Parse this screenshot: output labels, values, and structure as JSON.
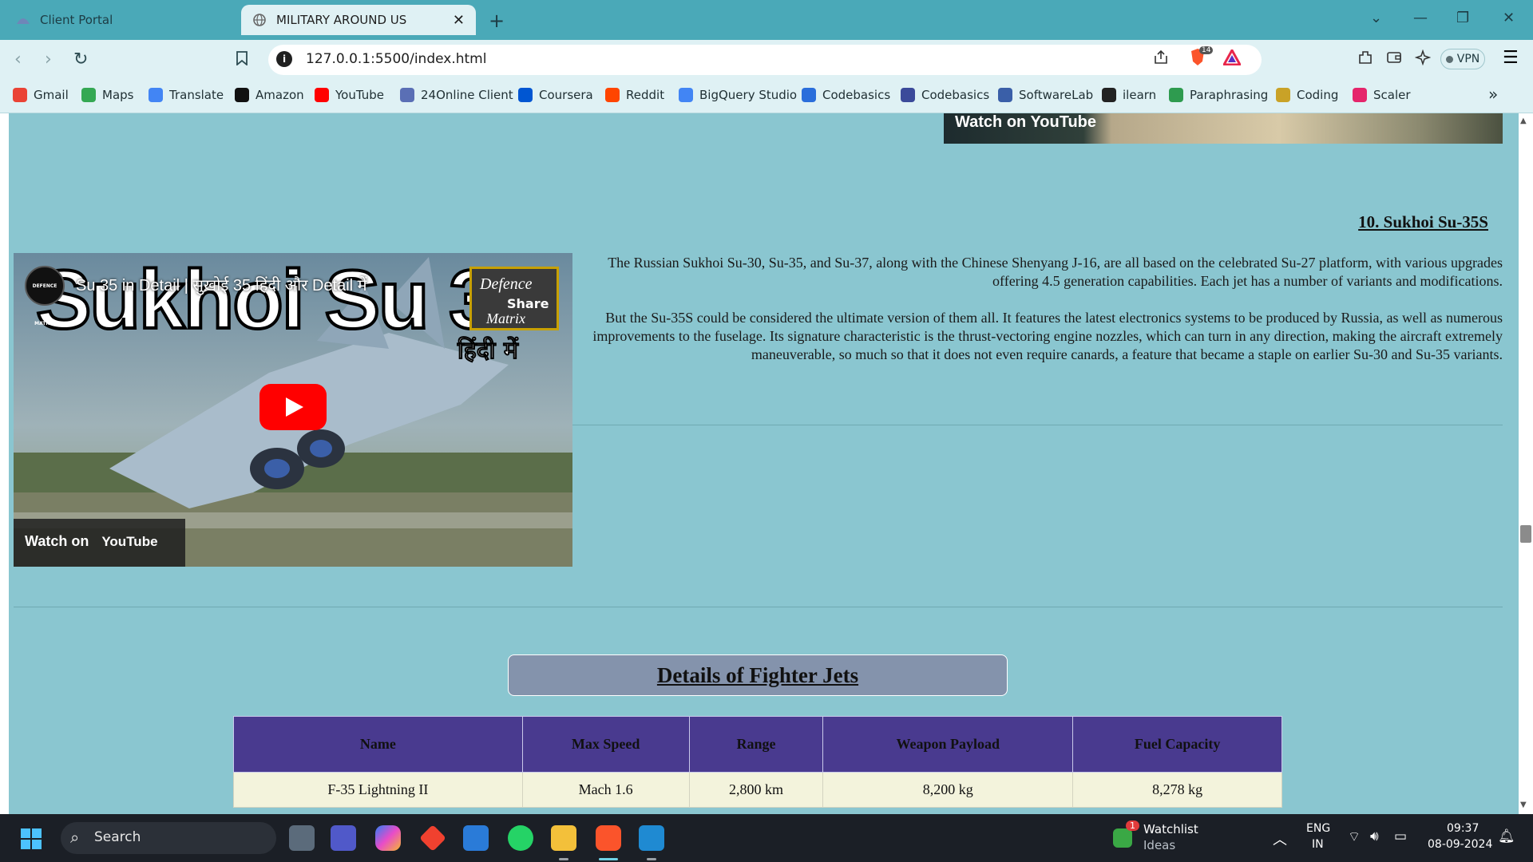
{
  "browser": {
    "tabs": [
      {
        "label": "Client Portal"
      },
      {
        "label": "MILITARY AROUND US"
      }
    ],
    "url": "127.0.0.1:5500/index.html",
    "vpn_label": "VPN",
    "shield_count": "14",
    "bookmarks": [
      {
        "label": "Gmail",
        "icon": "gmail-icon",
        "color": "#ea4335"
      },
      {
        "label": "Maps",
        "icon": "maps-icon",
        "color": "#34a853"
      },
      {
        "label": "Translate",
        "icon": "translate-icon",
        "color": "#4285f4"
      },
      {
        "label": "Amazon",
        "icon": "amazon-icon",
        "color": "#111111"
      },
      {
        "label": "YouTube",
        "icon": "youtube-icon",
        "color": "#ff0000"
      },
      {
        "label": "24Online Client",
        "icon": "24online-icon",
        "color": "#5a6fb5"
      },
      {
        "label": "Coursera",
        "icon": "coursera-icon",
        "color": "#0056d2"
      },
      {
        "label": "Reddit",
        "icon": "reddit-icon",
        "color": "#ff4500"
      },
      {
        "label": "BigQuery Studio",
        "icon": "bigquery-icon",
        "color": "#4285f4"
      },
      {
        "label": "Codebasics",
        "icon": "codebasics-rocket-icon",
        "color": "#2a6edb"
      },
      {
        "label": "Codebasics",
        "icon": "codebasics-icon",
        "color": "#3b4a9a"
      },
      {
        "label": "SoftwareLab",
        "icon": "softwarelab-icon",
        "color": "#3a5fa8"
      },
      {
        "label": "ilearn",
        "icon": "ilearn-icon",
        "color": "#222222"
      },
      {
        "label": "Paraphrasing",
        "icon": "paraphrasing-icon",
        "color": "#2e9b4f"
      },
      {
        "label": "Coding",
        "icon": "coding-icon",
        "color": "#c9a227"
      },
      {
        "label": "Scaler",
        "icon": "scaler-icon",
        "color": "#e5256b"
      }
    ]
  },
  "page": {
    "prev_video_text": "Watch on YouTube",
    "section_title": "10. Sukhoi Su-35S",
    "paragraphs": [
      "The Russian Sukhoi Su-30, Su-35, and Su-37, along with the Chinese Shenyang J-16, are all based on the celebrated Su-27 platform, with various upgrades offering 4.5 generation capabilities. Each jet has a number of variants and modifications.",
      "But the Su-35S could be considered the ultimate version of them all. It features the latest electronics systems to be produced by Russia, as well as numerous improvements to the fuselage. Its signature characteristic is the thrust-vectoring engine nozzles, which can turn in any direction, making the aircraft extremely maneuverable, so much so that it does not even require canards, a feature that became a staple on earlier Su-30 and Su-35 variants."
    ],
    "video": {
      "title": "Su 35 in Detail | सुखोई 35 हिंदी और Detail में",
      "big_text": "Sukhoi Su 35",
      "hindi_text": "हिंदी में",
      "badge": [
        "Defence",
        "Share",
        "Matrix"
      ],
      "channel": "DEFENCE MATRIX",
      "watch_on": "Watch on",
      "yt_label": "YouTube"
    },
    "details_heading": "Details of Fighter Jets",
    "table": {
      "headers": [
        "Name",
        "Max Speed",
        "Range",
        "Weapon Payload",
        "Fuel Capacity"
      ],
      "rows": [
        [
          "F-35 Lightning II",
          "Mach 1.6",
          "2,800 km",
          "8,200 kg",
          "8,278 kg"
        ]
      ]
    }
  },
  "taskbar": {
    "search_label": "Search",
    "watchlist_title": "Watchlist",
    "watchlist_sub": "Ideas",
    "watchlist_badge": "1",
    "lang_top": "ENG",
    "lang_bottom": "IN",
    "time": "09:37",
    "date": "08-09-2024"
  }
}
